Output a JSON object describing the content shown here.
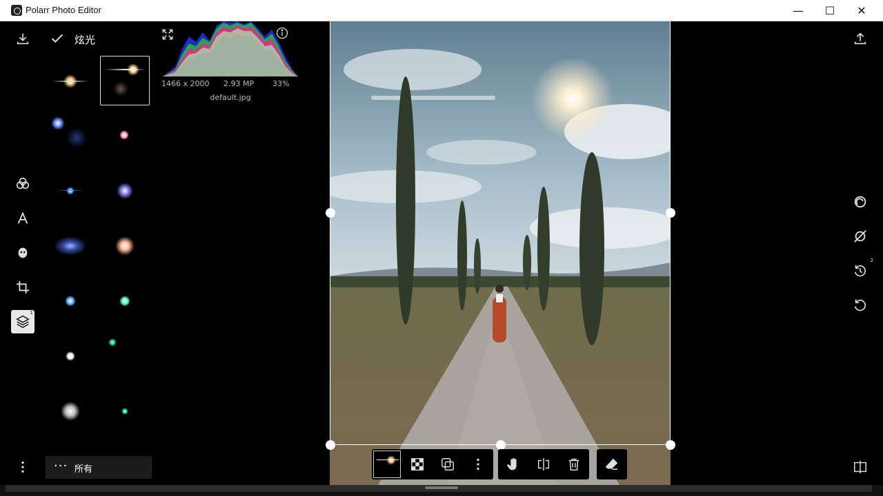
{
  "window": {
    "title": "Polarr Photo Editor"
  },
  "filter_panel": {
    "title": "炫光",
    "category_label": "所有"
  },
  "image_info": {
    "dimensions": "1466 x 2000",
    "megapixels": "2.93 MP",
    "zoom": "33%",
    "filename": "default.jpg"
  },
  "left_tools": {
    "layers_badge": "1"
  },
  "right_tools": {
    "history_badge": "2"
  },
  "icons": {
    "download": "download-icon",
    "check": "check-icon",
    "expand": "expand-icon",
    "info": "info-icon",
    "filters": "filters-icon",
    "text": "text-icon",
    "face": "face-icon",
    "crop": "crop-icon",
    "layers": "layers-icon",
    "more": "more-vertical-icon",
    "export": "export-icon",
    "retouch": "retouch-icon",
    "masks": "mask-off-icon",
    "history": "history-icon",
    "reset": "reset-icon",
    "compare": "compare-icon",
    "overlay": "overlay-thumb",
    "transparency": "checker-icon",
    "blend": "blend-icon",
    "hand": "hand-icon",
    "flip": "flip-icon",
    "trash": "trash-icon",
    "eraser": "eraser-icon"
  },
  "colors": {
    "accent": "#ffffff",
    "background": "#000000",
    "panel": "#1c1c1c"
  }
}
